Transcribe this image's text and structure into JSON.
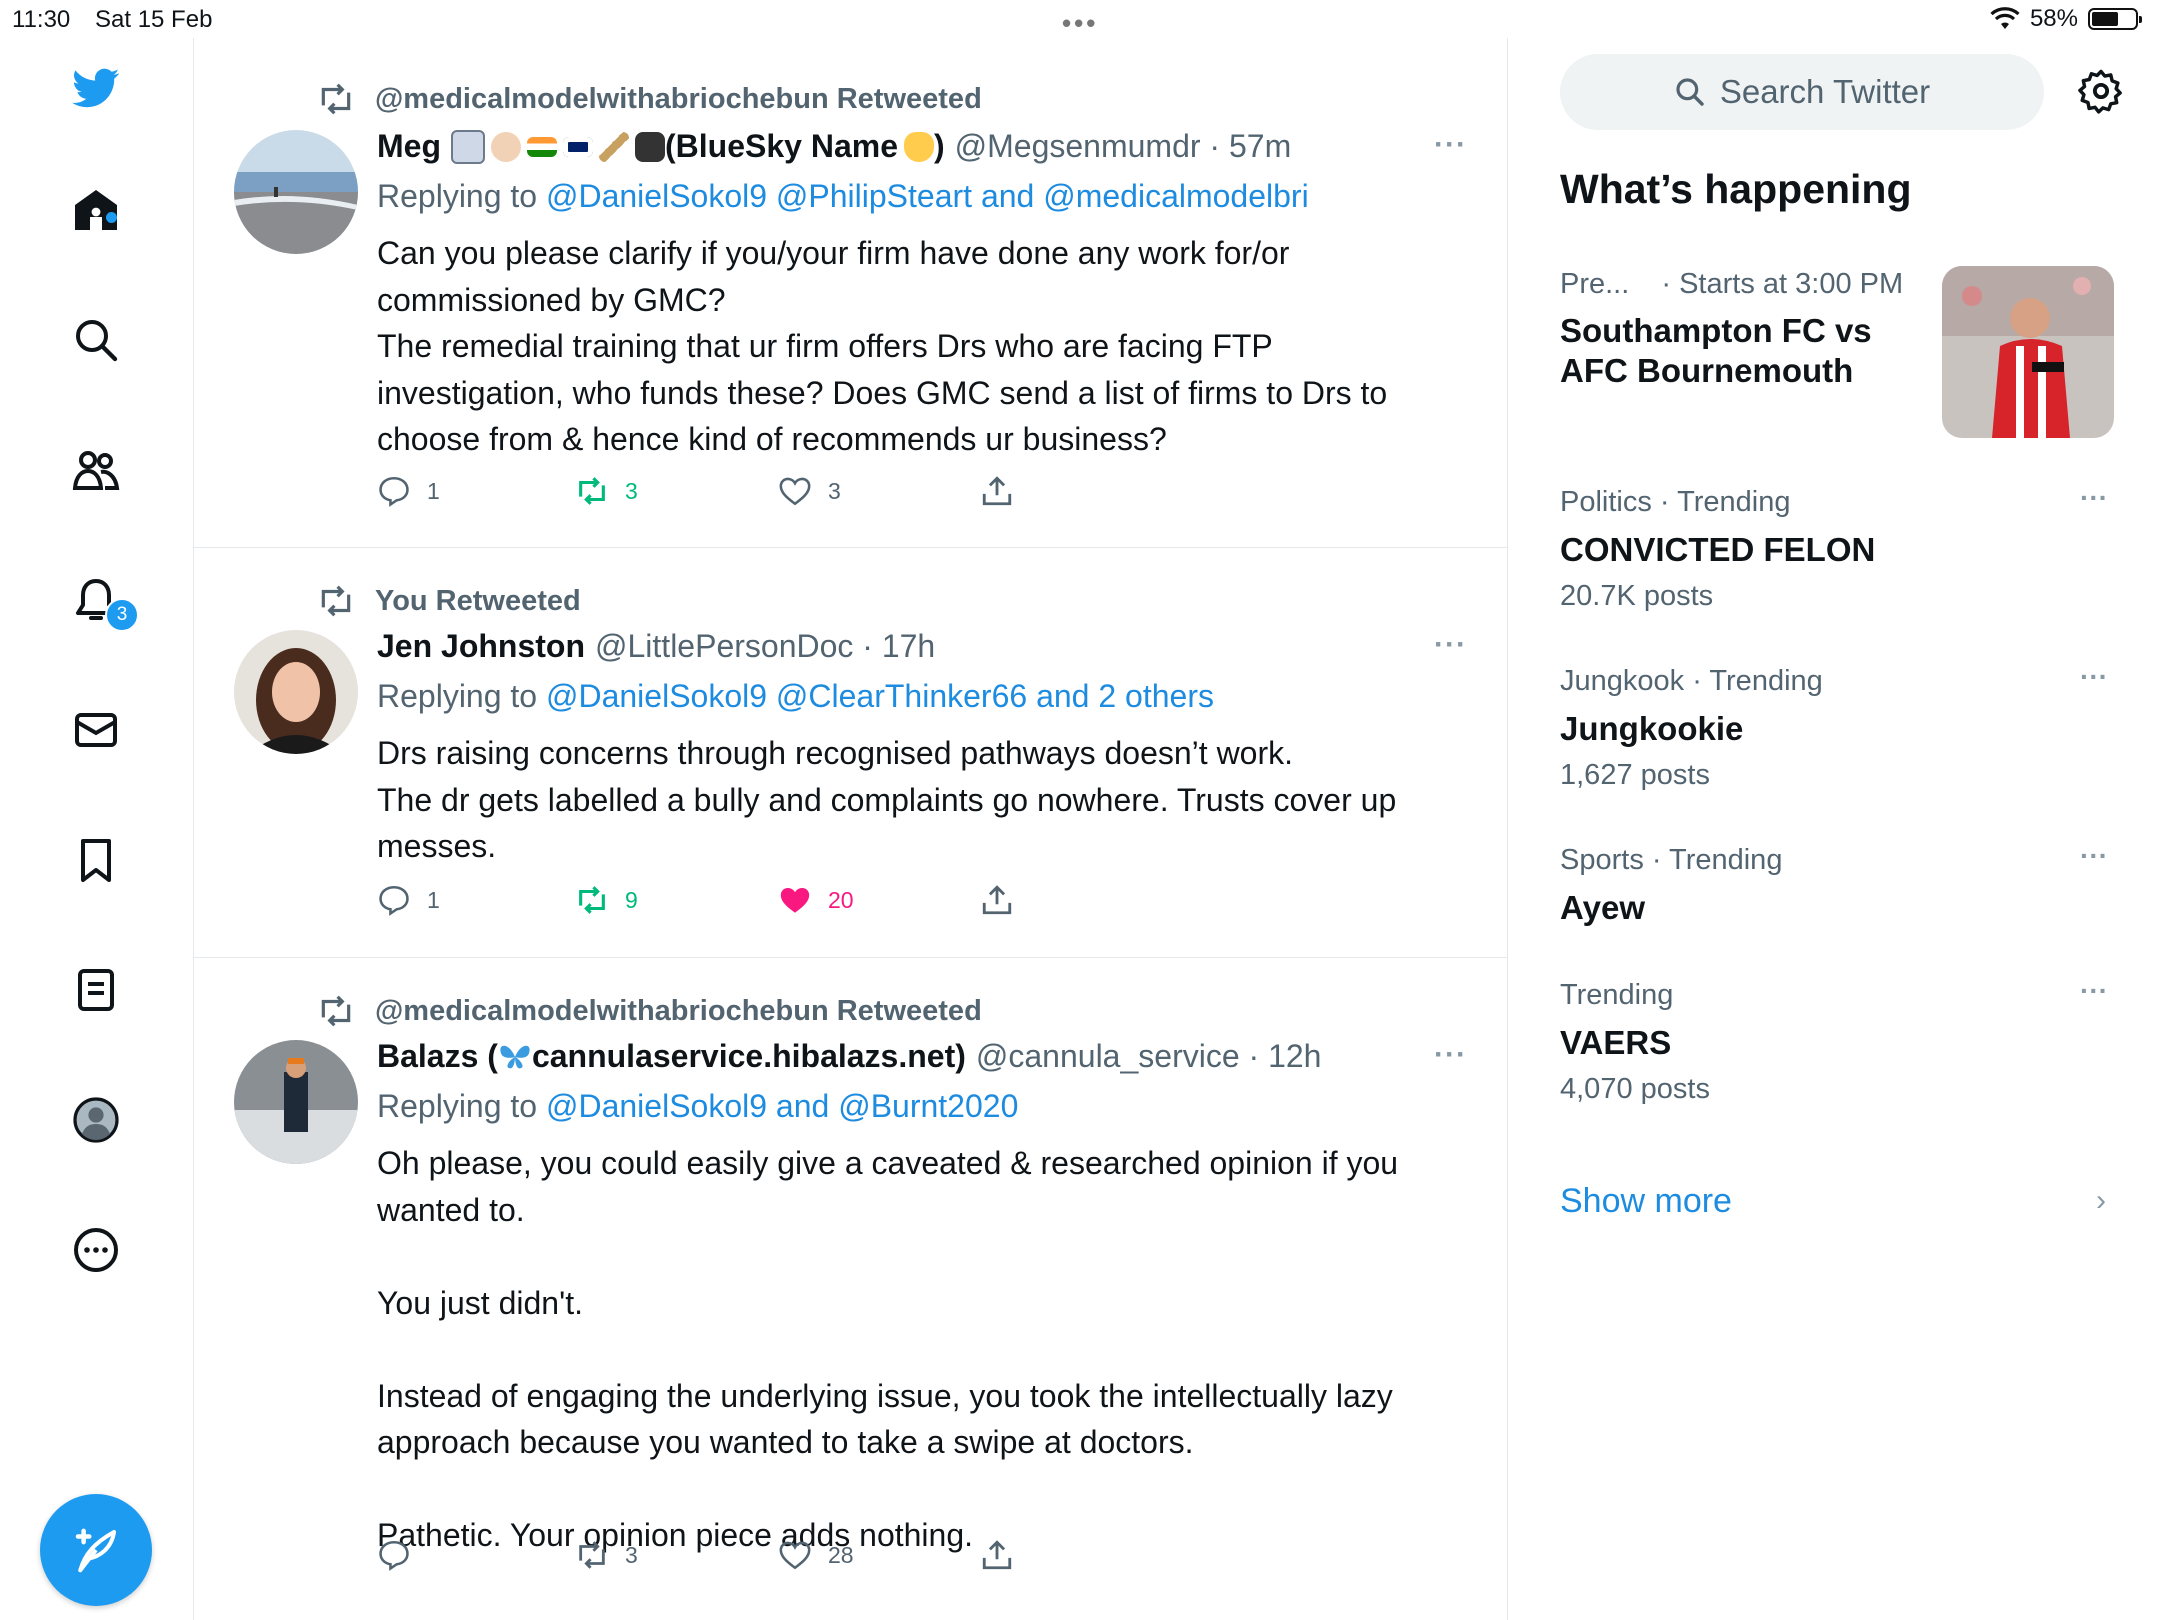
{
  "status_bar": {
    "time": "11:30",
    "date": "Sat 15 Feb",
    "battery": "58%"
  },
  "nav": {
    "notification_count": "3",
    "items": [
      "twitter-logo",
      "home-icon",
      "search-icon",
      "communities-icon",
      "notifications-icon",
      "messages-icon",
      "bookmarks-icon",
      "lists-icon",
      "profile-icon",
      "more-icon"
    ]
  },
  "tweets": [
    {
      "retweet_by": "@medicalmodelwithabriochebun Retweeted",
      "name": "Meg",
      "name_suffix": "(BlueSky Name",
      "name_close": ")",
      "handle_time": "@Megsenmumdr · 57m",
      "replying_prefix": "Replying to",
      "replying_to": "@DanielSokol9 @PhilipSteart and @medicalmodelbri",
      "text": "Can you please clarify if you/your firm have done any work for/or\ncommissioned by GMC?\nThe remedial training that ur firm offers Drs who are facing FTP\ninvestigation, who funds these? Does GMC send a list of firms to Drs to\nchoose from & hence kind of recommends ur business?",
      "replies": "1",
      "retweets": "3",
      "likes": "3",
      "liked": false,
      "retweeted": true
    },
    {
      "retweet_by": "You Retweeted",
      "name": "Jen Johnston",
      "handle_time": "@LittlePersonDoc · 17h",
      "replying_prefix": "Replying to",
      "replying_to": "@DanielSokol9 @ClearThinker66 and 2 others",
      "text": "Drs raising concerns through recognised pathways doesn’t work.\nThe dr gets labelled a bully and complaints go nowhere. Trusts cover up\nmesses.",
      "replies": "1",
      "retweets": "9",
      "likes": "20",
      "liked": true,
      "retweeted": true
    },
    {
      "retweet_by": "@medicalmodelwithabriochebun Retweeted",
      "name": "Balazs (",
      "name_suffix": "cannulaservice.hibalazs.net)",
      "handle_time": "@cannula_service · 12h",
      "replying_prefix": "Replying to",
      "replying_to": "@DanielSokol9 and @Burnt2020",
      "text": "Oh please, you could easily give a caveated & researched opinion if you\nwanted to.\n\nYou just didn't.\n\nInstead of engaging the underlying issue, you took the intellectually lazy\napproach because you wanted to take a swipe at doctors.\n\nPathetic. Your opinion piece adds nothing.",
      "replies": "",
      "retweets": "3",
      "likes": "28",
      "liked": false,
      "retweeted": false
    }
  ],
  "sidebar": {
    "search_placeholder": "Search Twitter",
    "whats_happening": "What’s happening",
    "event": {
      "category": "Pre...",
      "time": "· Starts at 3:00 PM",
      "title_line1": "Southampton FC vs",
      "title_line2": "AFC Bournemouth"
    },
    "trends": [
      {
        "meta": "Politics · Trending",
        "title": "CONVICTED FELON",
        "count": "20.7K posts"
      },
      {
        "meta": "Jungkook · Trending",
        "title": "Jungkookie",
        "count": "1,627 posts"
      },
      {
        "meta": "Sports · Trending",
        "title": "Ayew",
        "count": ""
      },
      {
        "meta": "Trending",
        "title": "VAERS",
        "count": "4,070 posts"
      }
    ],
    "show_more": "Show more"
  },
  "colors": {
    "accent": "#1d9bf0",
    "retweet_green": "#00ba7c",
    "like_pink": "#f91880",
    "secondary_text": "#536471"
  }
}
